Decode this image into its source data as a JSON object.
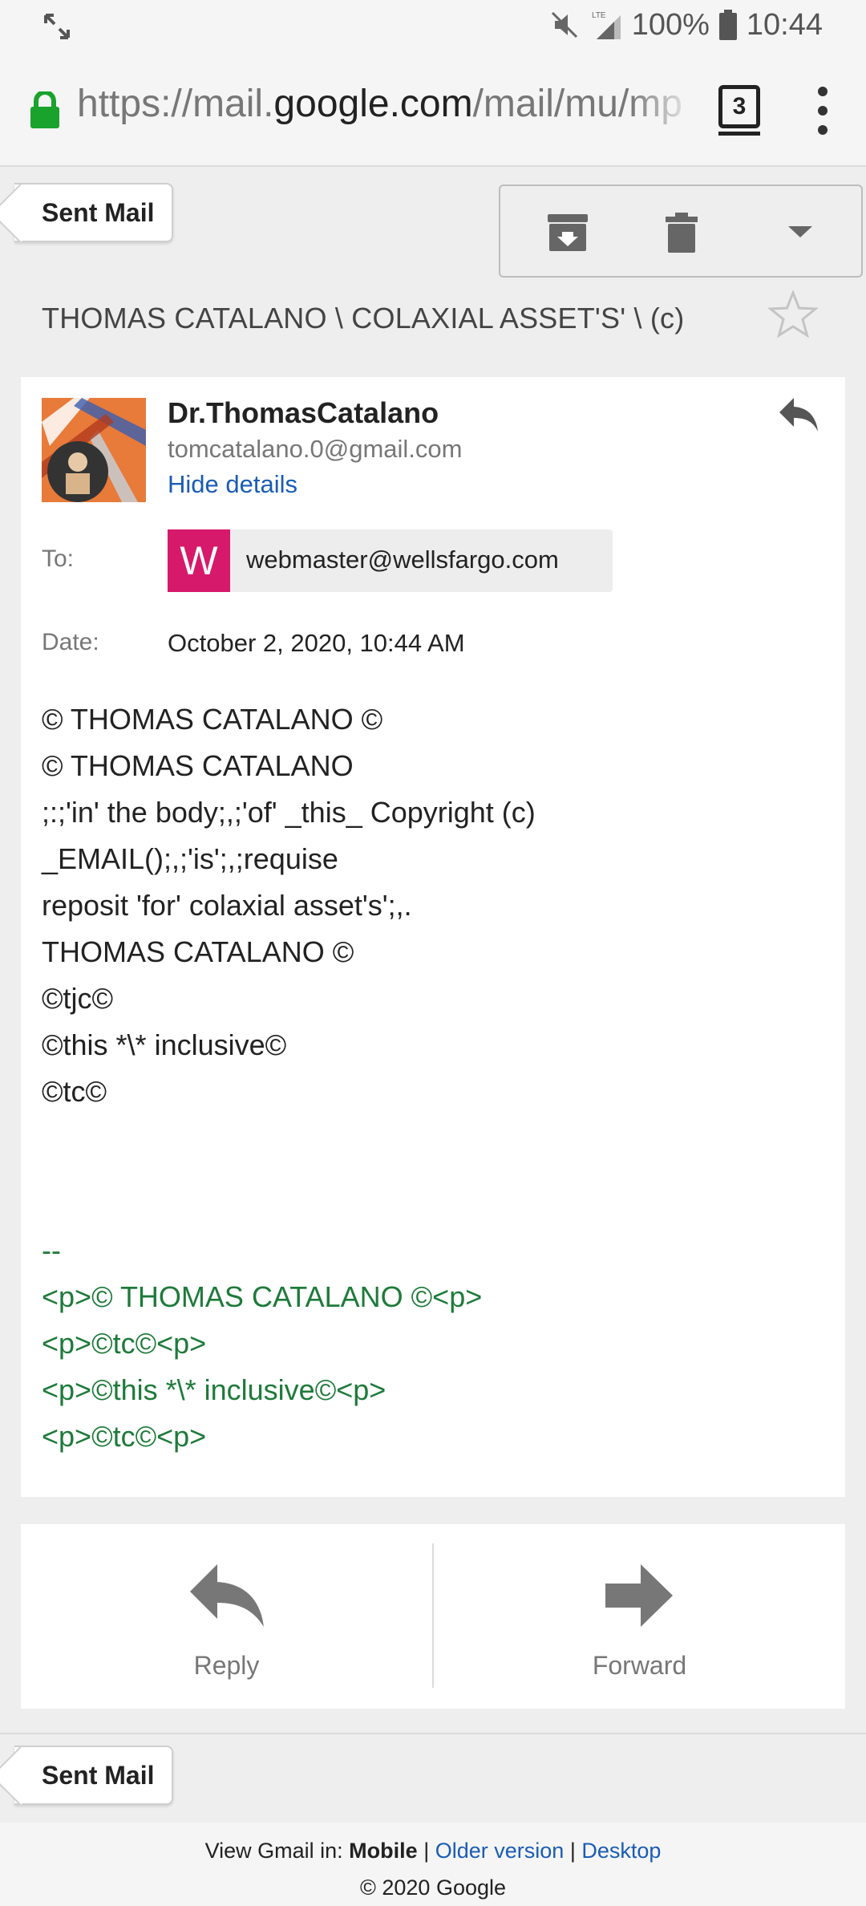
{
  "status_bar": {
    "battery": "100%",
    "time": "10:44",
    "network": "LTE"
  },
  "browser": {
    "url_prefix": "https://mail.",
    "url_domain": "google.com",
    "url_path": "/mail/mu/mp",
    "tab_count": "3"
  },
  "toolbar": {
    "back_label": "Sent Mail",
    "archive_icon": "archive-icon",
    "delete_icon": "trash-icon",
    "more_icon": "dropdown-icon"
  },
  "subject": "THOMAS CATALANO \\ COLAXIAL ASSET'S' \\ (c)",
  "message": {
    "sender_name": "Dr.ThomasCatalano",
    "sender_email": "tomcatalano.0@gmail.com",
    "hide_details": "Hide details",
    "to_label": "To:",
    "recipient_initial": "W",
    "recipient": "webmaster@wellsfargo.com",
    "date_label": "Date:",
    "date": "October 2, 2020, 10:44 AM",
    "body": [
      "© THOMAS CATALANO ©",
      "© THOMAS CATALANO",
      ";:;'in' the body;,;'of' _this_ Copyright (c) _EMAIL();,;'is';,;requise",
      "reposit 'for' colaxial asset's';,.",
      "THOMAS CATALANO ©",
      "©tjc©",
      "©this *\\* inclusive©",
      "©tc©"
    ],
    "signature": [
      "--",
      "<p>© THOMAS CATALANO ©<p>",
      "<p>©tc©<p>",
      "<p>©this *\\* inclusive©<p>",
      "<p>©tc©<p>"
    ]
  },
  "actions": {
    "reply": "Reply",
    "forward": "Forward"
  },
  "footer": {
    "view_in": "View Gmail in:",
    "mobile": "Mobile",
    "sep": "|",
    "older": "Older version",
    "desktop": "Desktop",
    "copyright": "© 2020 Google"
  },
  "colors": {
    "accent_link": "#1a5cb4",
    "signature_green": "#1e7a3a",
    "recipient_chip": "#d6196b",
    "lock_green": "#1aa32c"
  }
}
